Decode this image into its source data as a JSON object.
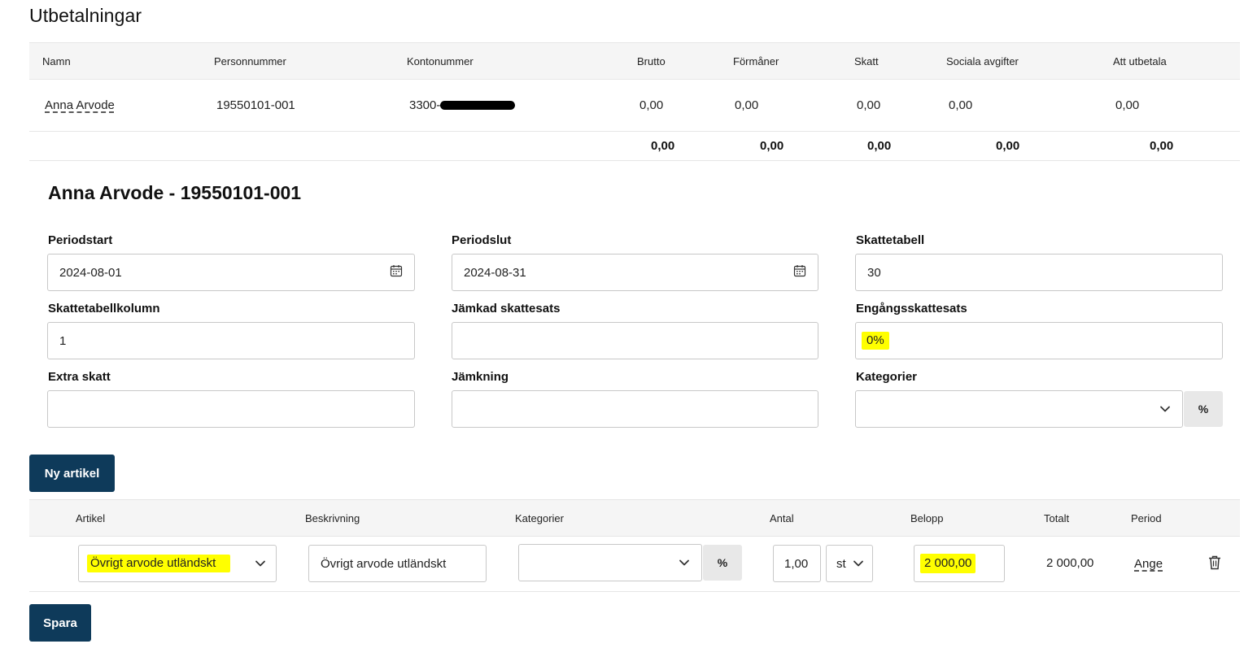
{
  "page": {
    "title": "Utbetalningar"
  },
  "payments": {
    "columns": [
      "Namn",
      "Personnummer",
      "Kontonummer",
      "Brutto",
      "Förmåner",
      "Skatt",
      "Sociala avgifter",
      "Att utbetala"
    ],
    "rows": [
      {
        "name": "Anna Arvode",
        "personnummer": "19550101-001",
        "kontonummer": "3300-",
        "brutto": "0,00",
        "formaner": "0,00",
        "skatt": "0,00",
        "sociala": "0,00",
        "att_utbetala": "0,00"
      }
    ],
    "totals": {
      "brutto": "0,00",
      "formaner": "0,00",
      "skatt": "0,00",
      "sociala": "0,00",
      "att_utbetala": "0,00"
    }
  },
  "employee": {
    "title": "Anna Arvode - 19550101-001",
    "fields": {
      "periodstart": {
        "label": "Periodstart",
        "value": "2024-08-01"
      },
      "periodslut": {
        "label": "Periodslut",
        "value": "2024-08-31"
      },
      "skattetabell": {
        "label": "Skattetabell",
        "value": "30"
      },
      "skattetabellkolumn": {
        "label": "Skattetabellkolumn",
        "value": "1"
      },
      "jamkad": {
        "label": "Jämkad skattesats",
        "value": ""
      },
      "engangs": {
        "label": "Engångsskattesats",
        "value": "0%"
      },
      "extra": {
        "label": "Extra skatt",
        "value": ""
      },
      "jamkning": {
        "label": "Jämkning",
        "value": ""
      },
      "kategorier": {
        "label": "Kategorier",
        "value": "",
        "addon": "%"
      }
    }
  },
  "buttons": {
    "new_article": "Ny artikel",
    "save": "Spara"
  },
  "articles": {
    "columns": [
      "Artikel",
      "Beskrivning",
      "Kategorier",
      "Antal",
      "Belopp",
      "Totalt",
      "Period"
    ],
    "rows": [
      {
        "artikel": "Övrigt arvode utländskt",
        "beskrivning": "Övrigt arvode utländskt",
        "kategorier": "",
        "kategori_addon": "%",
        "antal": "1,00",
        "enhet": "st",
        "belopp": "2 000,00",
        "totalt": "2 000,00",
        "period": "Ange"
      }
    ]
  },
  "icons": {
    "calendar": "calendar-icon",
    "chevron": "chevron-down-icon",
    "trash": "trash-icon"
  },
  "colors": {
    "primary_button": "#0e3a5a",
    "highlight": "#ffff00",
    "header_bg": "#f5f5f5"
  }
}
